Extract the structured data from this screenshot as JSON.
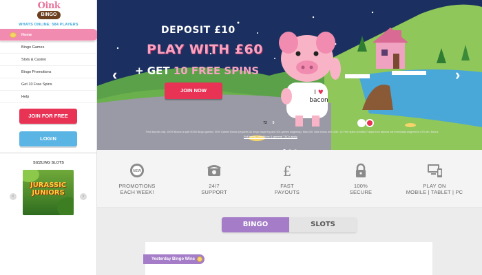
{
  "logo": {
    "name": "Oink",
    "sub": "BINGO"
  },
  "sidebar": {
    "whats_online": "WHATS ONLINE: 584 PLAYERS",
    "nav": [
      {
        "label": "Home",
        "active": true
      },
      {
        "label": "Bingo Games"
      },
      {
        "label": "Slots & Casino"
      },
      {
        "label": "Bingo Promotions"
      },
      {
        "label": "Get 10 Free Spins"
      },
      {
        "label": "Help"
      }
    ],
    "join_label": "JOIN FOR FREE",
    "login_label": "LOGIN",
    "sizzling_title": "SIZZLING SLOTS",
    "slot_name": "JURASSIC JUNIORS",
    "prev_icon": "chevron-left-icon",
    "next_icon": "chevron-right-icon"
  },
  "hero": {
    "line1": "DEPOSIT £10",
    "line2": "PLAY WITH £60",
    "line3_prefix": "+ GET ",
    "line3_highlight": "10 FREE SPINS",
    "cta": "JOIN NOW",
    "shirt_line1": "I",
    "shirt_heart": "♥",
    "shirt_line2": "bacon",
    "ball1": "72",
    "ball2": "5",
    "terms": "First deposit only. 100% Bonus is split 50/50 Bingo games / 50% Games Bonus (requires 4x bingo wagering and 40x games wagering). Max £50. Max bonus win £250. 10 Free spins credited 7 days from deposit will eventually wagered to £75 win. Bonus",
    "terms_link": "Full terms, conditions & general T&Cs apply",
    "slides": 3,
    "active_slide": 0,
    "colors": {
      "sky": "#1b3060",
      "hill": "#8fc75a",
      "cta": "#e83355",
      "pink_text": "#f7a3c1"
    }
  },
  "features": [
    {
      "icon": "new-badge-icon",
      "line1": "PROMOTIONS",
      "line2": "EACH WEEK!"
    },
    {
      "icon": "phone-icon",
      "line1": "24/7",
      "line2": "SUPPORT"
    },
    {
      "icon": "pound-icon",
      "line1": "FAST",
      "line2": "PAYOUTS"
    },
    {
      "icon": "lock-icon",
      "line1": "100%",
      "line2": "SECURE"
    },
    {
      "icon": "devices-icon",
      "line1": "PLAY ON",
      "line2": "MOBILE | TABLET | PC"
    }
  ],
  "tabs": {
    "bingo": "BINGO",
    "slots": "SLOTS",
    "active": "bingo"
  },
  "wins": {
    "label": "Yesterday Bingo Wins"
  },
  "colors": {
    "accent_pink": "#f28bb0",
    "accent_red": "#e83355",
    "accent_blue": "#5ab4e4",
    "accent_purple": "#a47cc7"
  }
}
